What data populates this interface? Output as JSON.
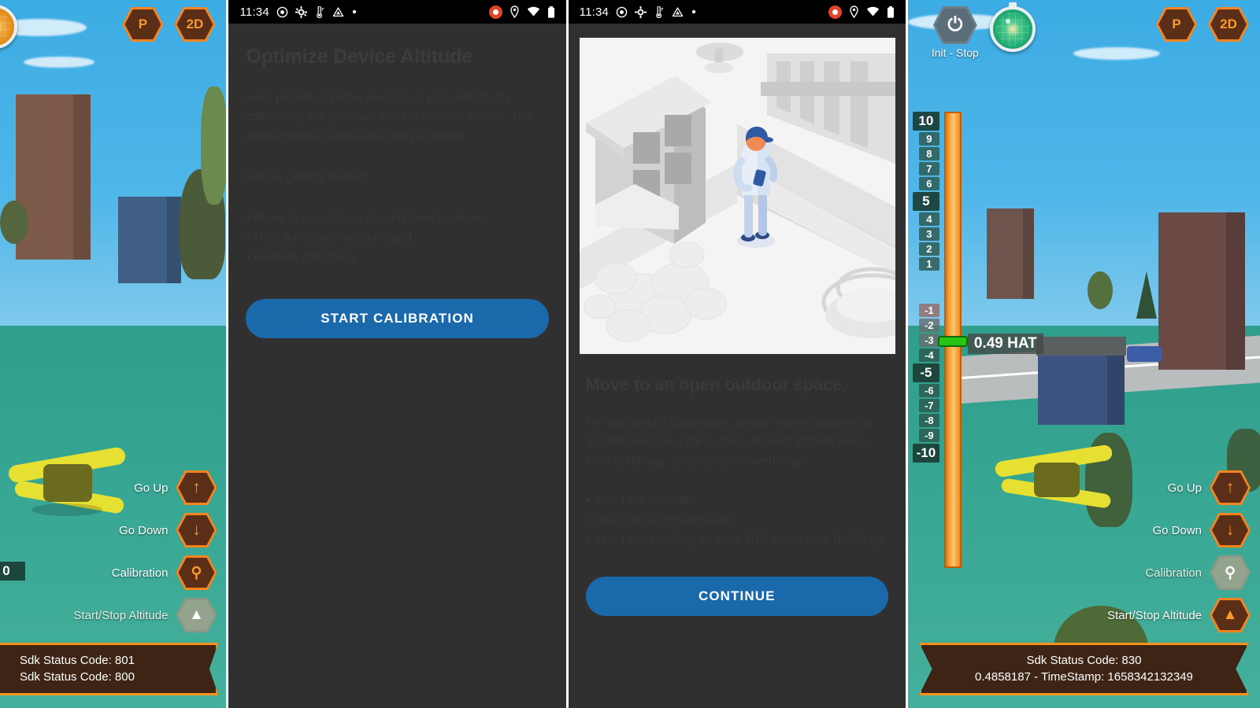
{
  "panels": {
    "sim_left": {
      "hex_buttons": [
        {
          "label": "P",
          "name": "projection-button"
        },
        {
          "label": "2D",
          "name": "view-mode-button"
        }
      ],
      "controls": [
        {
          "label": "Go Up",
          "icon": "arrow-up-icon",
          "state": "active"
        },
        {
          "label": "Go Down",
          "icon": "arrow-down-icon",
          "state": "active"
        },
        {
          "label": "Calibration",
          "icon": "location-pin-icon",
          "state": "active"
        },
        {
          "label": "Start/Stop Altitude",
          "icon": "altitude-icon",
          "state": "disabled"
        }
      ],
      "status_lines": [
        "Sdk Status Code: 801",
        "Sdk Status Code: 800"
      ],
      "partial_tape_label": "0"
    },
    "phone_one": {
      "statusbar": {
        "time": "11:34",
        "left_icons": [
          "camera-record-icon",
          "gear-icon",
          "thermometer-icon",
          "triangle-drive-icon",
          "dot-icon"
        ],
        "right_icons": [
          "record-indicator-icon",
          "location-pin-icon",
          "wifi-icon",
          "battery-icon"
        ]
      },
      "title": "Optimize Device Altitude",
      "body": "Help provide a better reading of your altitude by calibrating the pressure sensor on your device. The entire process takes less than a minute.",
      "subhead": "Before getting started:",
      "bullets": [
        "• Move to an outdoor ground level location",
        "• Hold the phone in your hand",
        "• Remain stationary"
      ],
      "cta": "START CALIBRATION"
    },
    "phone_two": {
      "statusbar": {
        "time": "11:34",
        "left_icons": [
          "camera-record-icon",
          "gear-icon",
          "thermometer-icon",
          "triangle-drive-icon",
          "dot-icon"
        ],
        "right_icons": [
          "record-indicator-icon",
          "location-pin-icon",
          "wifi-icon",
          "battery-icon"
        ]
      },
      "illustration": "isometric-person-outdoors-illustration",
      "title": "Move to an open outdoor space.",
      "body": "For successful calibration, please move outdoors at ground level on a flat surface at least 10 feet away from buildings, structures, or overhangs.",
      "bullets": [
        "• Yes, I am outside.",
        "• Yes, I am at ground level.",
        "• Yes, I am standing at least 10 ft away from buildings."
      ],
      "cta": "CONTINUE"
    },
    "sim_right": {
      "init_stop": {
        "label": "Init - Stop",
        "icon": "power-icon"
      },
      "radar": {
        "name": "radar-gauge"
      },
      "hex_buttons": [
        {
          "label": "P",
          "name": "projection-button"
        },
        {
          "label": "2D",
          "name": "view-mode-button"
        }
      ],
      "altitude_tape": {
        "positive_ticks": [
          "10",
          "9",
          "8",
          "7",
          "6",
          "5",
          "4",
          "3",
          "2",
          "1"
        ],
        "negative_ticks": [
          "-1",
          "-2",
          "-3",
          "-4",
          "-5",
          "-6",
          "-7",
          "-8",
          "-9",
          "-10"
        ],
        "major_ticks": [
          "10",
          "5",
          "-5",
          "-10"
        ],
        "reading": "0.49 HAT"
      },
      "controls": [
        {
          "label": "Go Up",
          "icon": "arrow-up-icon",
          "state": "active"
        },
        {
          "label": "Go Down",
          "icon": "arrow-down-icon",
          "state": "active"
        },
        {
          "label": "Calibration",
          "icon": "location-pin-icon",
          "state": "disabled"
        },
        {
          "label": "Start/Stop Altitude",
          "icon": "altitude-icon",
          "state": "active"
        }
      ],
      "status_lines": [
        "Sdk Status Code: 830",
        "0.4858187 - TimeStamp: 1658342132349"
      ]
    }
  },
  "colors": {
    "accent_orange": "#f7931e",
    "button_blue": "#1a69ab",
    "banner_brown": "#3d2415",
    "sky_blue": "#3cace4",
    "ground_teal": "#35a592",
    "marker_green": "#28c415"
  }
}
